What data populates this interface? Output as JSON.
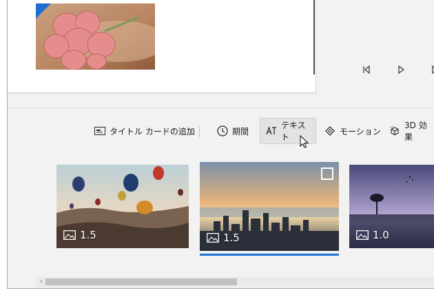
{
  "player": {
    "controls": [
      "step-back-icon",
      "play-icon",
      "step-forward-icon"
    ]
  },
  "toolbar": {
    "add_title_card": "タイトル カードの追加",
    "duration": "期間",
    "text": "テキスト",
    "motion": "モーション",
    "effects_3d": "3D 効果"
  },
  "storyboard": {
    "clips": [
      {
        "duration": "1.5",
        "name": "clip-balloons",
        "selected": false
      },
      {
        "duration": "1.5",
        "name": "clip-city-sunset",
        "selected": true
      },
      {
        "duration": "1.0",
        "name": "clip-tree-lake",
        "selected": false
      }
    ]
  },
  "colors": {
    "accent": "#1e73d2",
    "background": "#f2f2f2"
  }
}
